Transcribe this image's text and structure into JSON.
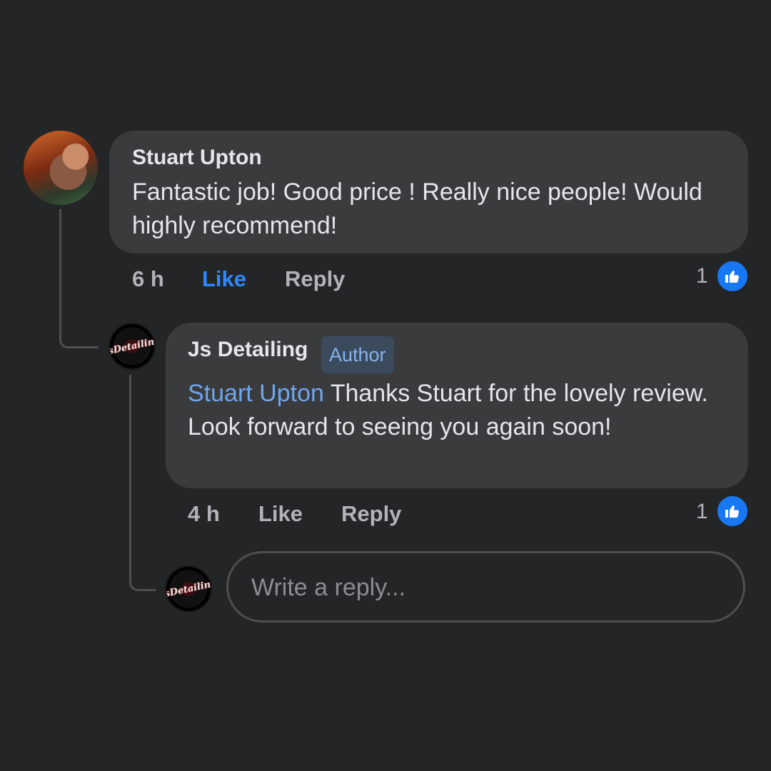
{
  "thread": {
    "comment": {
      "author": "Stuart Upton",
      "text": "Fantastic job! Good price ! Really nice people! Would highly recommend!",
      "time": "6 h",
      "like_label": "Like",
      "like_state": "liked",
      "reply_label": "Reply",
      "reaction_count": "1",
      "reaction_icon": "thumbs-up-icon"
    },
    "reply": {
      "author": "Js Detailing",
      "badge": "Author",
      "mention": "Stuart Upton",
      "text": " Thanks Stuart for the lovely review. Look forward to seeing you again soon!",
      "time": "4 h",
      "like_label": "Like",
      "reply_label": "Reply",
      "reaction_count": "1",
      "reaction_icon": "thumbs-up-icon"
    },
    "reply_box": {
      "placeholder": "Write a reply..."
    }
  },
  "colors": {
    "background": "#242526",
    "bubble": "#3a3b3c",
    "accent": "#2d88ff",
    "mention": "#6fa6ee"
  }
}
